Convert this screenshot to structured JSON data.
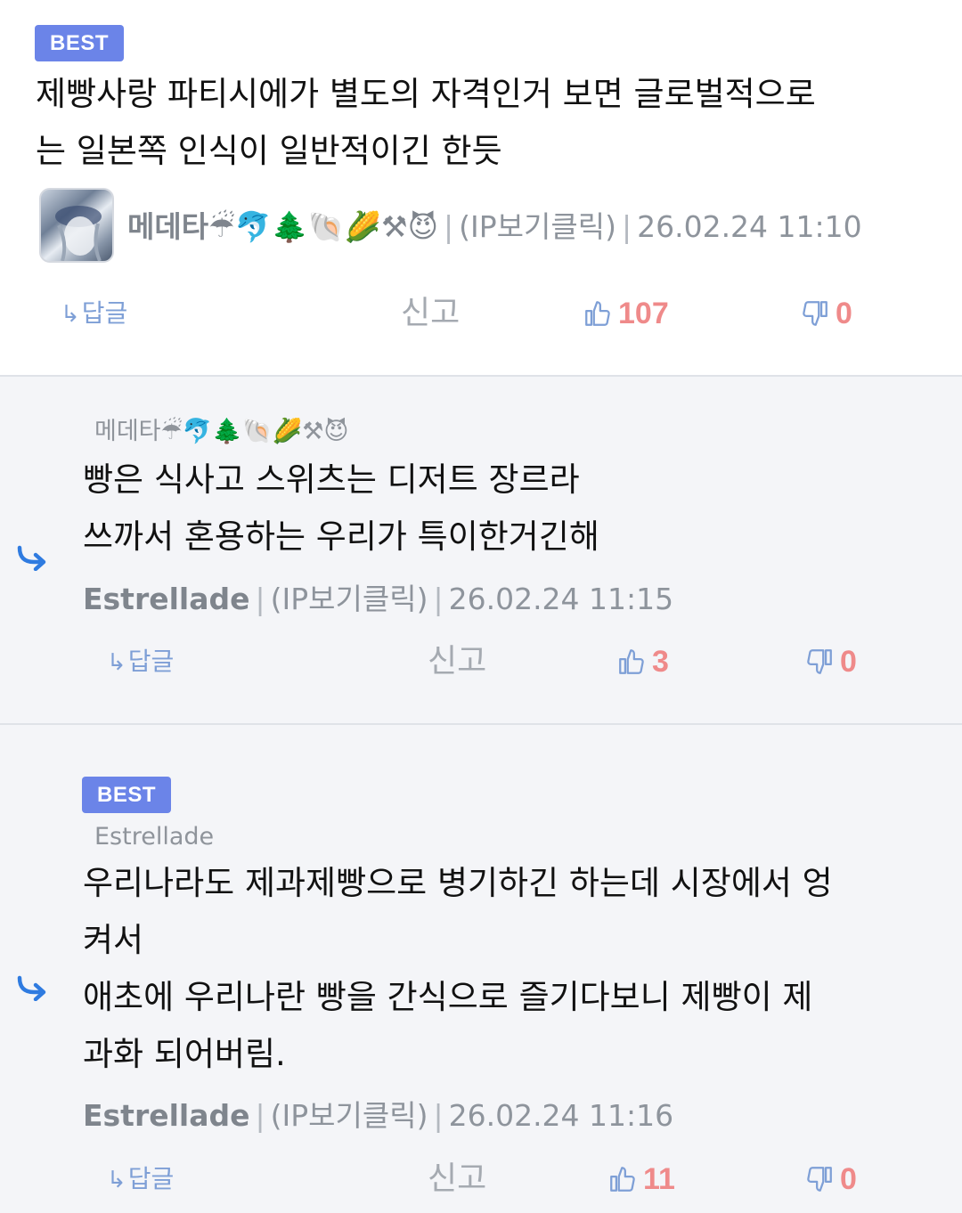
{
  "comments": [
    {
      "badge": "BEST",
      "text": "제빵사랑 파티시에가 별도의 자격인거 보면 글로벌적으로\n는 일본쪽 인식이 일반적이긴 한듯",
      "author": "메데타☔🐬🌲🐚🌽⚒😈",
      "ip": "(IP보기클릭)",
      "date": "26.02.24 11:10",
      "reply_label": "답글",
      "report_label": "신고",
      "upvotes": "107",
      "downvotes": "0"
    },
    {
      "parent": "메데타☔🐬🌲🐚🌽⚒😈",
      "text": "빵은 식사고 스위츠는 디저트 장르라\n쓰까서 혼용하는 우리가 특이한거긴해",
      "author": "Estrellade",
      "ip": "(IP보기클릭)",
      "date": "26.02.24 11:15",
      "reply_label": "답글",
      "report_label": "신고",
      "upvotes": "3",
      "downvotes": "0"
    },
    {
      "badge": "BEST",
      "parent": "Estrellade",
      "text": "우리나라도 제과제빵으로 병기하긴 하는데 시장에서 엉\n켜서\n애초에 우리나란 빵을 간식으로 즐기다보니 제빵이 제\n과화 되어버림.",
      "author": "Estrellade",
      "ip": "(IP보기클릭)",
      "date": "26.02.24 11:16",
      "reply_label": "답글",
      "report_label": "신고",
      "upvotes": "11",
      "downvotes": "0"
    }
  ],
  "icons": {
    "reply": "reply-arrow-icon",
    "thumb_up": "thumbs-up-icon",
    "thumb_down": "thumbs-down-icon",
    "nested": "nested-reply-icon"
  },
  "colors": {
    "badge": "#6b84e8",
    "vote_count": "#ef8a8a",
    "reply_link": "#7e9fd6",
    "reply_bg": "#f4f5f8"
  }
}
